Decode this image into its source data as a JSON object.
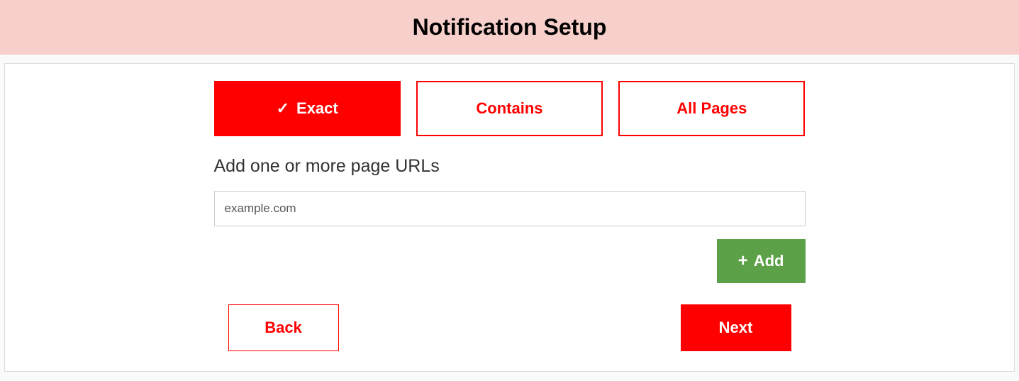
{
  "header": {
    "title": "Notification Setup"
  },
  "tabs": {
    "exact": "Exact",
    "contains": "Contains",
    "all_pages": "All Pages"
  },
  "form": {
    "label": "Add one or more page URLs",
    "url_value": "example.com",
    "add_button": "Add"
  },
  "nav": {
    "back": "Back",
    "next": "Next"
  }
}
